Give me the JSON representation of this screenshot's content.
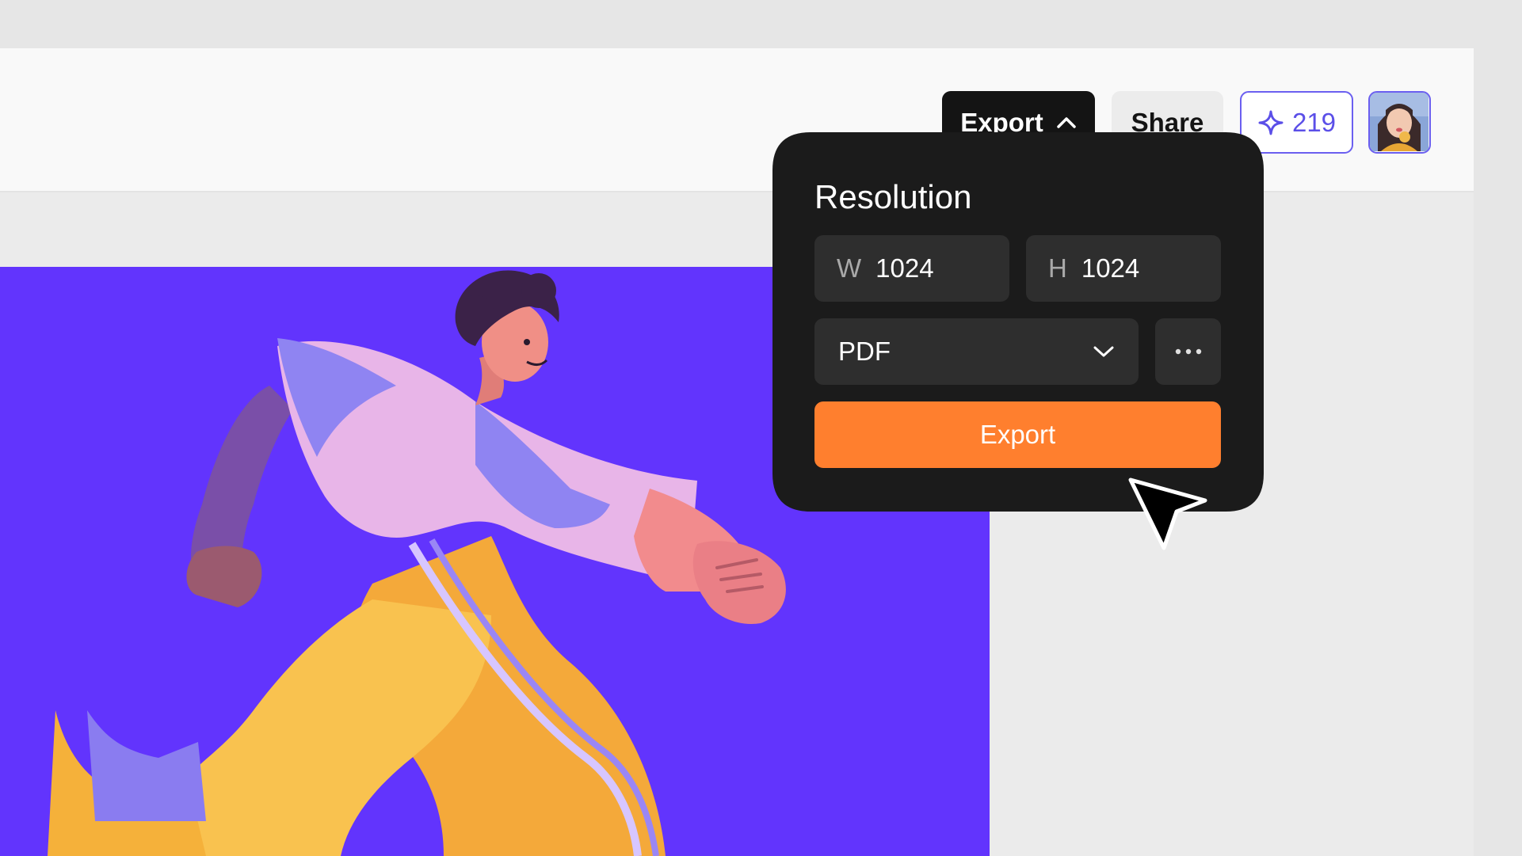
{
  "toolbar": {
    "export_label": "Export",
    "share_label": "Share",
    "credits_count": "219"
  },
  "export_popover": {
    "title": "Resolution",
    "width_label": "W",
    "width_value": "1024",
    "height_label": "H",
    "height_value": "1024",
    "format_value": "PDF",
    "export_button_label": "Export"
  },
  "colors": {
    "canvas_bg": "#6234fd",
    "export_accent": "#ff7f2e",
    "credits_accent": "#5b4fe8",
    "popover_bg": "#1b1b1b"
  },
  "icons": [
    "chevron-up-icon",
    "sparkle-icon",
    "chevron-down-icon",
    "more-horizontal-icon",
    "cursor-icon"
  ]
}
